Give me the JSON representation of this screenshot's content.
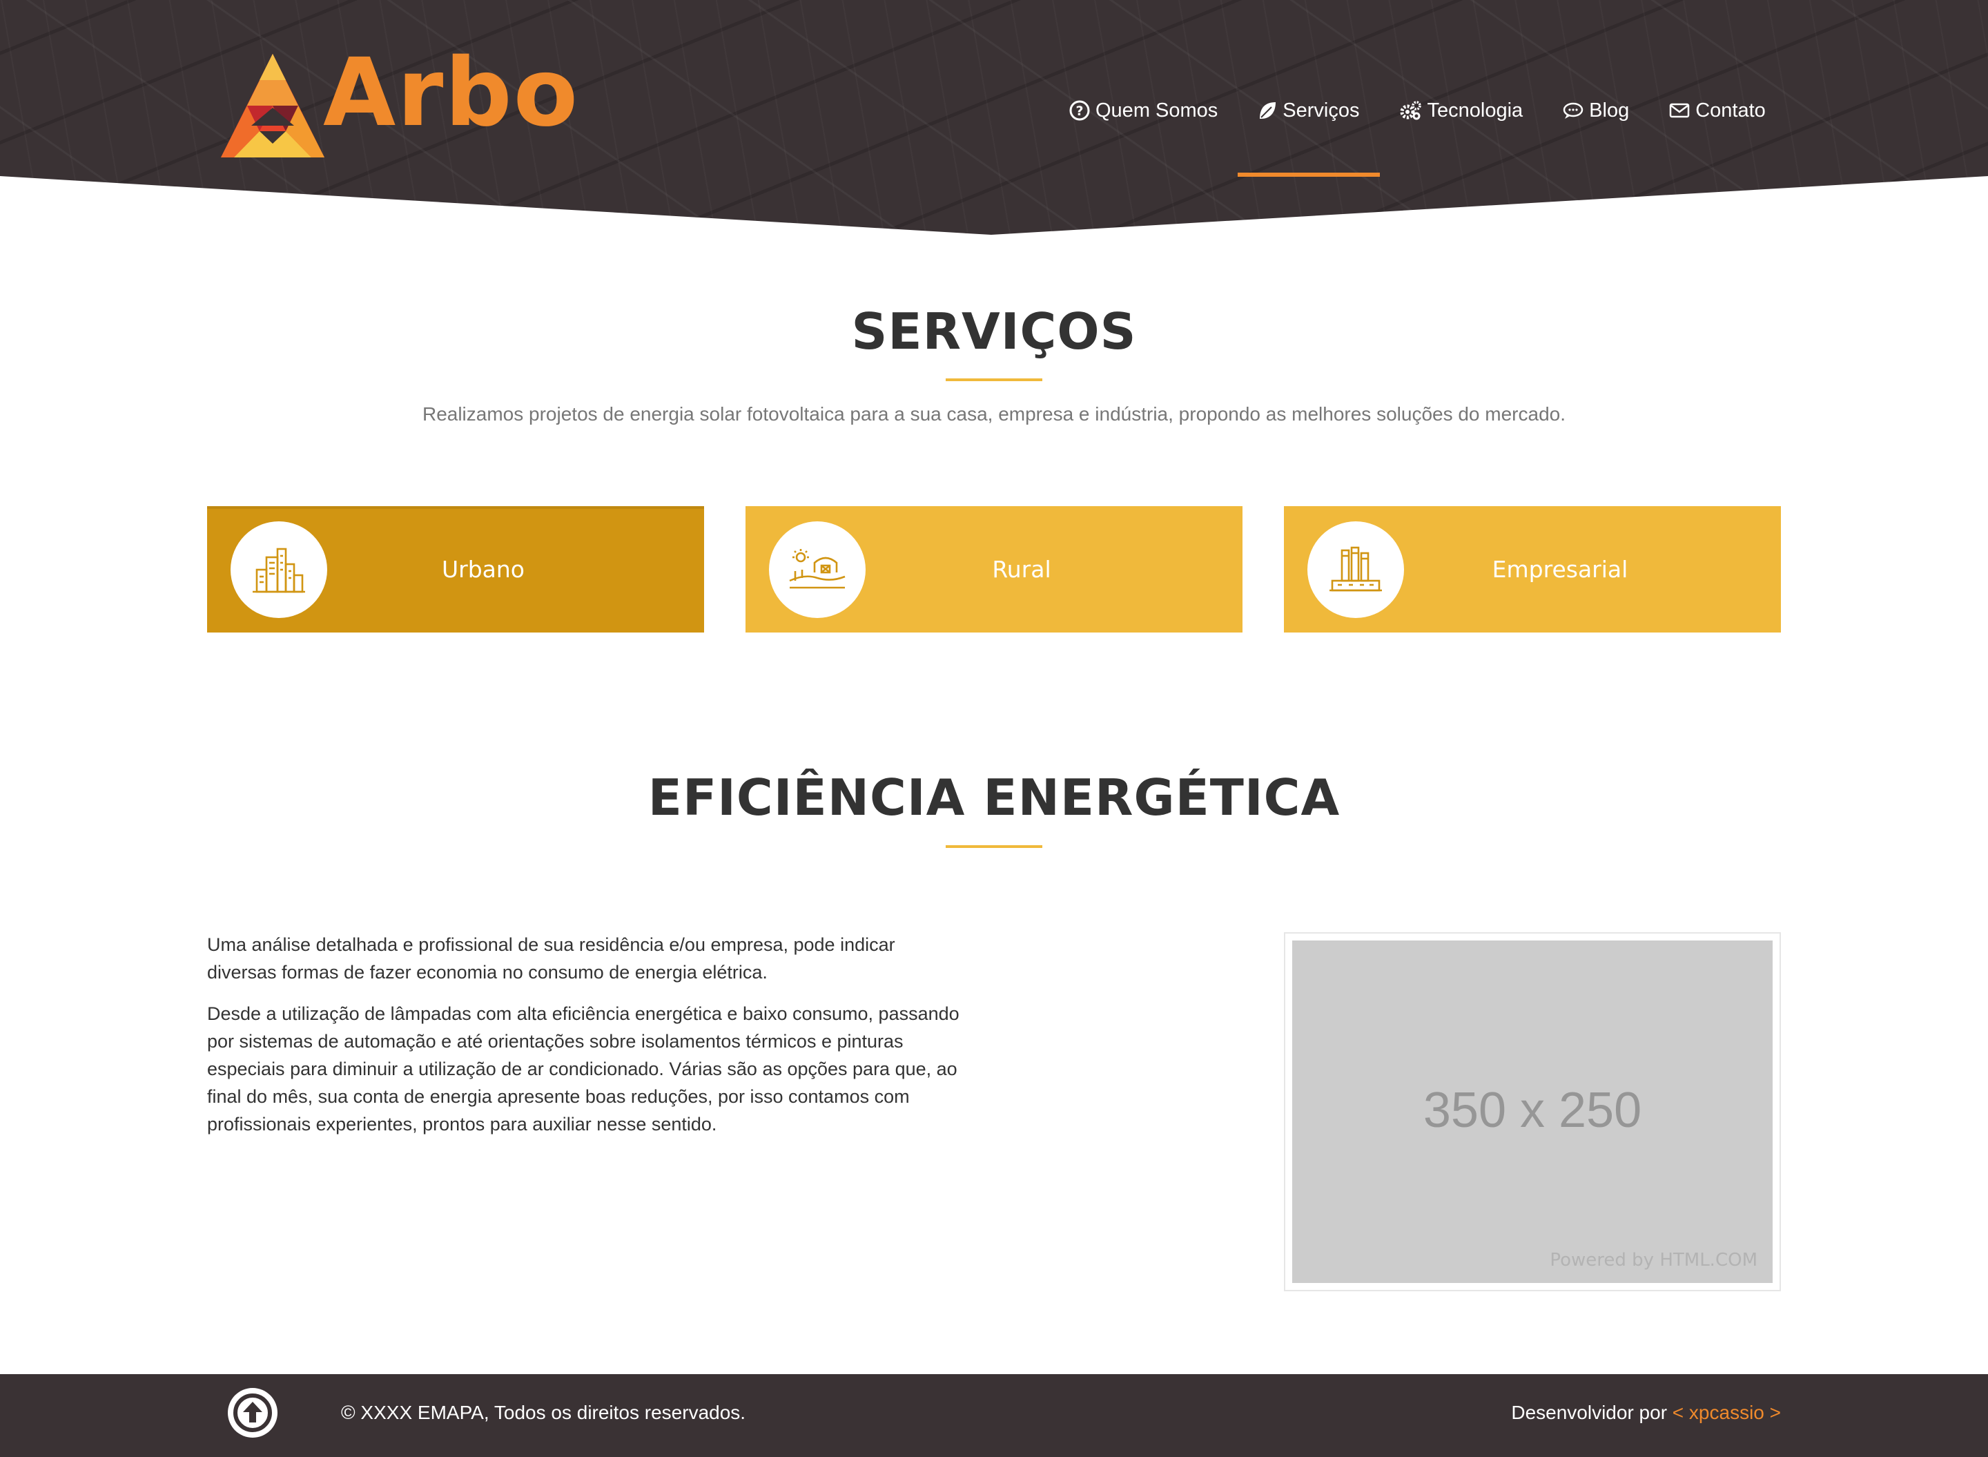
{
  "brand": {
    "name": "Arbo",
    "accent": "#f08a2c",
    "dark": "#3a3234",
    "yellow": "#f0b93b",
    "yellow_active": "#d19512"
  },
  "nav": {
    "items": [
      {
        "label": "Quem Somos",
        "icon": "question-circle-icon"
      },
      {
        "label": "Serviços",
        "icon": "leaf-icon",
        "active": true
      },
      {
        "label": "Tecnologia",
        "icon": "gears-icon"
      },
      {
        "label": "Blog",
        "icon": "chat-bubble-icon"
      },
      {
        "label": "Contato",
        "icon": "envelope-icon"
      }
    ]
  },
  "services": {
    "title": "SERVIÇOS",
    "subtitle": "Realizamos projetos de energia solar fotovoltaica para a sua casa, empresa e indústria, propondo as melhores soluções do mercado.",
    "cards": [
      {
        "label": "Urbano",
        "icon": "city-buildings-icon",
        "active": true
      },
      {
        "label": "Rural",
        "icon": "farm-barn-icon"
      },
      {
        "label": "Empresarial",
        "icon": "factory-icon"
      }
    ]
  },
  "efficiency": {
    "title": "EFICIÊNCIA ENERGÉTICA",
    "paragraphs": [
      "Uma análise detalhada e profissional de sua residência e/ou empresa, pode indicar diversas formas de fazer economia no consumo de energia elétrica.",
      "Desde a utilização de lâmpadas com alta eficiência energética e baixo consumo, passando por sistemas de automação e até orientações sobre isolamentos térmicos e pinturas especiais para diminuir a utilização de ar condicionado. Várias são as opções para que, ao final do mês, sua conta de energia apresente boas reduções, por isso contamos com profissionais experientes, prontos para auxiliar nesse sentido."
    ],
    "image": {
      "dimensions": "350 x 250",
      "powered": "Powered by HTML.COM"
    }
  },
  "footer": {
    "copyright": "© XXXX EMAPA, Todos os direitos reservados.",
    "dev_prefix": "Desenvolvidor por",
    "dev_link": "< xpcassio >",
    "to_top_icon": "arrow-up-circle-icon"
  }
}
